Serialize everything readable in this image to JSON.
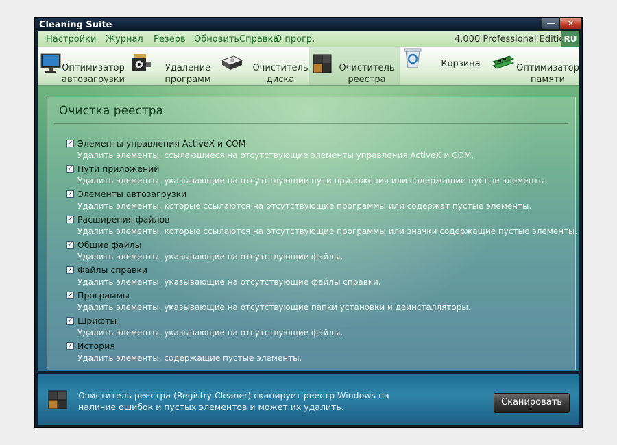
{
  "window": {
    "title": "Cleaning Suite",
    "minimize_glyph": "—",
    "close_glyph": "✕"
  },
  "menu": {
    "items": [
      "Настройки",
      "Журнал",
      "Резерв",
      "Обновить",
      "Справка",
      "О прогр."
    ],
    "edition": "4.000 Professional Edition",
    "language": "RU"
  },
  "tabs": [
    {
      "label": "Оптимизатор\nавтозагрузки",
      "icon": "monitor-icon"
    },
    {
      "label": "Удаление\nпрограмм",
      "icon": "film-projector-icon"
    },
    {
      "label": "Очиститель\nдиска",
      "icon": "hard-drive-icon"
    },
    {
      "label": "Очиститель\nреестра",
      "icon": "registry-cubes-icon",
      "active": true
    },
    {
      "label": "Корзина",
      "icon": "recycle-bin-icon"
    },
    {
      "label": "Оптимизатор\nпамяти",
      "icon": "memory-module-icon"
    }
  ],
  "panel": {
    "title": "Очистка реестра",
    "options": [
      {
        "label": "Элементы управления ActiveX и COM",
        "desc": "Удалить элементы, ссылающиеся на отсутствующие элементы управления ActiveX и COM.",
        "checked": true
      },
      {
        "label": "Пути приложений",
        "desc": "Удалить элементы, указывающие на отсутствующие пути приложения или содержащие пустые элементы.",
        "checked": true
      },
      {
        "label": "Элементы автозагрузки",
        "desc": "Удалить элементы, которые ссылаются на отсутствующие программы или содержат пустые элементы.",
        "checked": true
      },
      {
        "label": "Расширения файлов",
        "desc": "Удалить элементы, которые ссылаются на отсутствующие программы или значки содержащие пустые элементы.",
        "checked": true
      },
      {
        "label": "Общие файлы",
        "desc": "Удалить элементы, указывающие на отсутствующие файлы.",
        "checked": true
      },
      {
        "label": "Файлы справки",
        "desc": "Удалить элементы, указывающие на отсутствующие файлы справки.",
        "checked": true
      },
      {
        "label": "Программы",
        "desc": "Удалить элементы, указывающие на отсутствующие папки установки и деинсталляторы.",
        "checked": true
      },
      {
        "label": "Шрифты",
        "desc": "Удалить элементы, указывающие на отсутствующие файлы.",
        "checked": true
      },
      {
        "label": "История",
        "desc": "Удалить элементы, содержащие пустые элементы.",
        "checked": true
      }
    ]
  },
  "footer": {
    "line1": "Очиститель реестра (Registry Cleaner) сканирует реестр Windows на",
    "line2": "наличие ошибок и пустых элементов и может их удалить.",
    "scan_button": "Сканировать",
    "icon": "registry-cubes-icon"
  },
  "colors": {
    "menu_text": "#1e6b2a",
    "content_top": "#6fb57e",
    "content_bottom": "#2f6a8a",
    "footer": "#2f84a8"
  }
}
